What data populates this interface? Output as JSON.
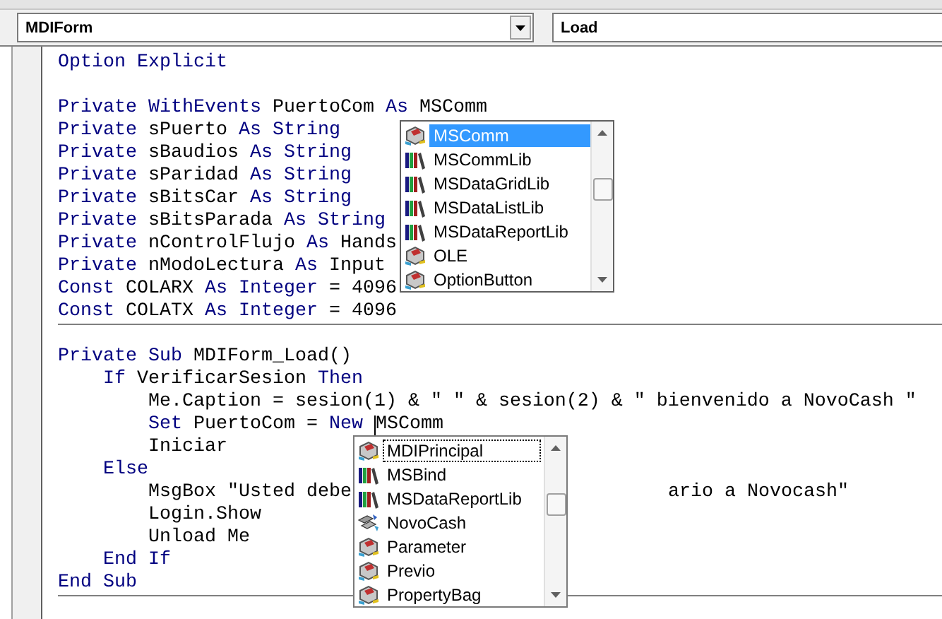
{
  "object_combo": {
    "value": "MDIForm"
  },
  "procedure_combo": {
    "value": "Load"
  },
  "code_sections": [
    {
      "lines": [
        {
          "tokens": [
            {
              "kind": "keyword",
              "text": "Option Explicit"
            }
          ]
        },
        {
          "gap_before": true,
          "tokens": [
            {
              "kind": "keyword",
              "text": "Private WithEvents"
            },
            {
              "kind": "plain",
              "text": " PuertoCom "
            },
            {
              "kind": "keyword",
              "text": "As"
            },
            {
              "kind": "plain",
              "text": " MSComm"
            }
          ]
        },
        {
          "tokens": [
            {
              "kind": "keyword",
              "text": "Private"
            },
            {
              "kind": "plain",
              "text": " sPuerto "
            },
            {
              "kind": "keyword",
              "text": "As String"
            }
          ]
        },
        {
          "tokens": [
            {
              "kind": "keyword",
              "text": "Private"
            },
            {
              "kind": "plain",
              "text": " sBaudios "
            },
            {
              "kind": "keyword",
              "text": "As String"
            }
          ]
        },
        {
          "tokens": [
            {
              "kind": "keyword",
              "text": "Private"
            },
            {
              "kind": "plain",
              "text": " sParidad "
            },
            {
              "kind": "keyword",
              "text": "As String"
            }
          ]
        },
        {
          "tokens": [
            {
              "kind": "keyword",
              "text": "Private"
            },
            {
              "kind": "plain",
              "text": " sBitsCar "
            },
            {
              "kind": "keyword",
              "text": "As String"
            }
          ]
        },
        {
          "tokens": [
            {
              "kind": "keyword",
              "text": "Private"
            },
            {
              "kind": "plain",
              "text": " sBitsParada "
            },
            {
              "kind": "keyword",
              "text": "As String"
            }
          ]
        },
        {
          "tokens": [
            {
              "kind": "keyword",
              "text": "Private"
            },
            {
              "kind": "plain",
              "text": " nControlFlujo "
            },
            {
              "kind": "keyword",
              "text": "As"
            },
            {
              "kind": "plain",
              "text": " Hands"
            }
          ]
        },
        {
          "tokens": [
            {
              "kind": "keyword",
              "text": "Private"
            },
            {
              "kind": "plain",
              "text": " nModoLectura "
            },
            {
              "kind": "keyword",
              "text": "As"
            },
            {
              "kind": "plain",
              "text": " Input"
            }
          ]
        },
        {
          "tokens": [
            {
              "kind": "keyword",
              "text": "Const"
            },
            {
              "kind": "plain",
              "text": " COLARX "
            },
            {
              "kind": "keyword",
              "text": "As Integer"
            },
            {
              "kind": "plain",
              "text": " = 4096"
            }
          ]
        },
        {
          "tokens": [
            {
              "kind": "keyword",
              "text": "Const"
            },
            {
              "kind": "plain",
              "text": " COLATX "
            },
            {
              "kind": "keyword",
              "text": "As Integer"
            },
            {
              "kind": "plain",
              "text": " = 4096"
            }
          ]
        }
      ]
    },
    {
      "lines": [
        {
          "gap_before": true,
          "tokens": [
            {
              "kind": "keyword",
              "text": "Private Sub"
            },
            {
              "kind": "plain",
              "text": " MDIForm_Load()"
            }
          ],
          "children": [
            {
              "tokens": [
                {
                  "kind": "keyword",
                  "text": "If"
                },
                {
                  "kind": "plain",
                  "text": " VerificarSesion "
                },
                {
                  "kind": "keyword",
                  "text": "Then"
                }
              ],
              "children": [
                {
                  "tokens": [
                    {
                      "kind": "plain",
                      "text": "Me.Caption = sesion(1) & \" \" & sesion(2) & \" bienvenido a NovoCash \""
                    }
                  ]
                },
                {
                  "tokens": [
                    {
                      "kind": "keyword",
                      "text": "Set"
                    },
                    {
                      "kind": "plain",
                      "text": " PuertoCom = "
                    },
                    {
                      "kind": "keyword",
                      "text": "New"
                    },
                    {
                      "kind": "caret"
                    },
                    {
                      "kind": "plain",
                      "text": "MSComm"
                    }
                  ]
                },
                {
                  "tokens": [
                    {
                      "kind": "plain",
                      "text": "Iniciar"
                    }
                  ]
                }
              ]
            },
            {
              "tokens": [
                {
                  "kind": "keyword",
                  "text": "Else"
                }
              ],
              "children": [
                {
                  "tokens": [
                    {
                      "kind": "plain",
                      "text": "MsgBox \"Usted debe"
                    },
                    {
                      "kind": "after_popup",
                      "text": "ario a Novocash\""
                    }
                  ]
                },
                {
                  "tokens": [
                    {
                      "kind": "plain",
                      "text": "Login.Show"
                    }
                  ]
                },
                {
                  "tokens": [
                    {
                      "kind": "plain",
                      "text": "Unload Me"
                    }
                  ]
                }
              ]
            },
            {
              "tokens": [
                {
                  "kind": "keyword",
                  "text": "End If"
                }
              ]
            }
          ]
        },
        {
          "tokens": [
            {
              "kind": "keyword",
              "text": "End Sub"
            }
          ]
        }
      ]
    }
  ],
  "completion_lists": [
    {
      "active": true,
      "items": [
        {
          "label": "MSComm",
          "kind": "class",
          "selected": true
        },
        {
          "label": "MSCommLib",
          "kind": "library",
          "selected": false
        },
        {
          "label": "MSDataGridLib",
          "kind": "library",
          "selected": false
        },
        {
          "label": "MSDataListLib",
          "kind": "library",
          "selected": false
        },
        {
          "label": "MSDataReportLib",
          "kind": "library",
          "selected": false
        },
        {
          "label": "OLE",
          "kind": "class",
          "selected": false
        },
        {
          "label": "OptionButton",
          "kind": "class",
          "selected": false
        }
      ]
    },
    {
      "active": false,
      "items": [
        {
          "label": "MDIPrincipal",
          "kind": "class",
          "selected": true
        },
        {
          "label": "MSBind",
          "kind": "library",
          "selected": false
        },
        {
          "label": "MSDataReportLib",
          "kind": "library",
          "selected": false
        },
        {
          "label": "NovoCash",
          "kind": "project",
          "selected": false
        },
        {
          "label": "Parameter",
          "kind": "class",
          "selected": false
        },
        {
          "label": "Previo",
          "kind": "class",
          "selected": false
        },
        {
          "label": "PropertyBag",
          "kind": "class",
          "selected": false
        }
      ]
    }
  ]
}
